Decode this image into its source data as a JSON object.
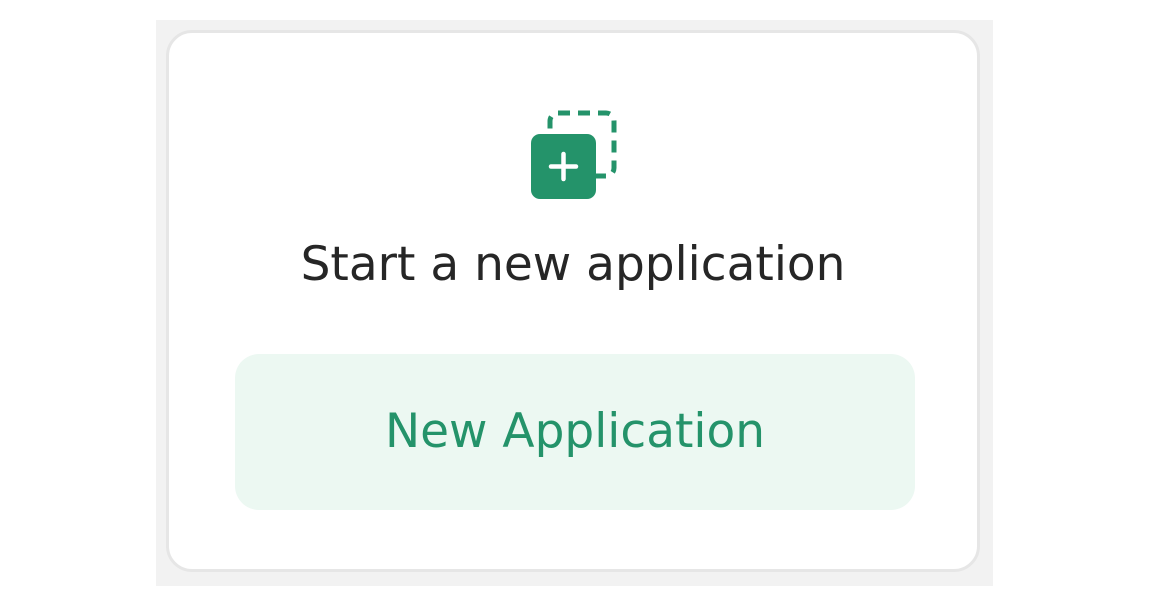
{
  "card": {
    "icon": "new-application-icon",
    "title": "Start a new application",
    "button_label": "New Application"
  },
  "colors": {
    "accent": "#24936a",
    "button_background": "#ecf8f2",
    "text": "#262626",
    "card_border": "#e6e6e6"
  }
}
